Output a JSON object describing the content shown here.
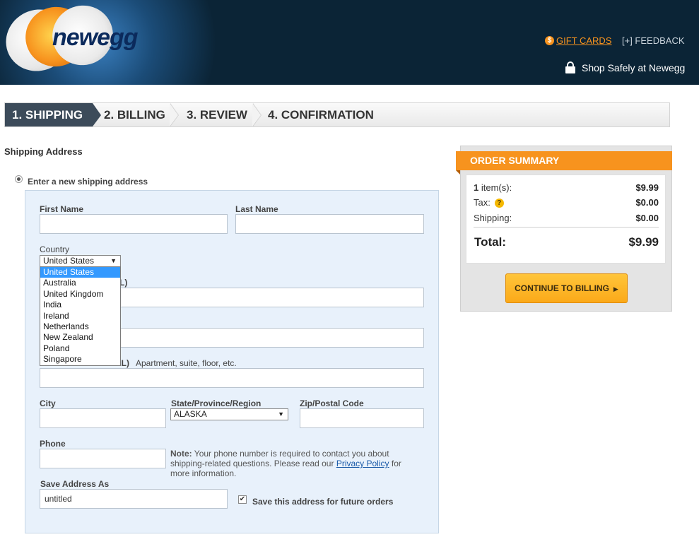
{
  "header": {
    "logo_text": "newegg",
    "gift_cards_label": "GIFT CARDS",
    "feedback_label": "[+] FEEDBACK",
    "shop_safely_label": "Shop Safely at Newegg"
  },
  "steps": [
    {
      "label": "1. SHIPPING",
      "active": true
    },
    {
      "label": "2. BILLING"
    },
    {
      "label": "3. REVIEW"
    },
    {
      "label": "4. CONFIRMATION"
    }
  ],
  "shipping": {
    "section_title": "Shipping Address",
    "option_label": "Enter a new shipping address",
    "fields": {
      "first_name_label": "First Name",
      "last_name_label": "Last Name",
      "country_label": "Country",
      "country_selected": "United States",
      "partial_label_1": "L)",
      "partial_label_2": "AL)",
      "address2_hint": "Apartment, suite, floor, etc.",
      "city_label": "City",
      "state_label": "State/Province/Region",
      "state_selected": "ALASKA",
      "zip_label": "Zip/Postal Code",
      "phone_label": "Phone",
      "note_bold": "Note:",
      "note_text": "Your phone number is required to contact you about shipping-related questions. Please read our",
      "note_link": "Privacy Policy",
      "note_tail": "for more information.",
      "save_as_label": "Save Address As",
      "save_as_value": "untitled",
      "save_checkbox_label": "Save this address for future orders",
      "save_checked": true
    },
    "country_options": [
      "United States",
      "Australia",
      "United Kingdom",
      "India",
      "Ireland",
      "Netherlands",
      "New Zealand",
      "Poland",
      "Singapore"
    ]
  },
  "summary": {
    "title": "ORDER SUMMARY",
    "items_qty": "1",
    "items_label": "item(s):",
    "items_value": "$9.99",
    "tax_label": "Tax:",
    "tax_value": "$0.00",
    "shipping_label": "Shipping:",
    "shipping_value": "$0.00",
    "total_label": "Total:",
    "total_value": "$9.99",
    "continue_label": "CONTINUE TO BILLING"
  },
  "colors": {
    "header_bg": "#0b2436",
    "accent_orange": "#f7931e",
    "step_active": "#3c4b5a",
    "form_bg": "#e8f1fb"
  }
}
